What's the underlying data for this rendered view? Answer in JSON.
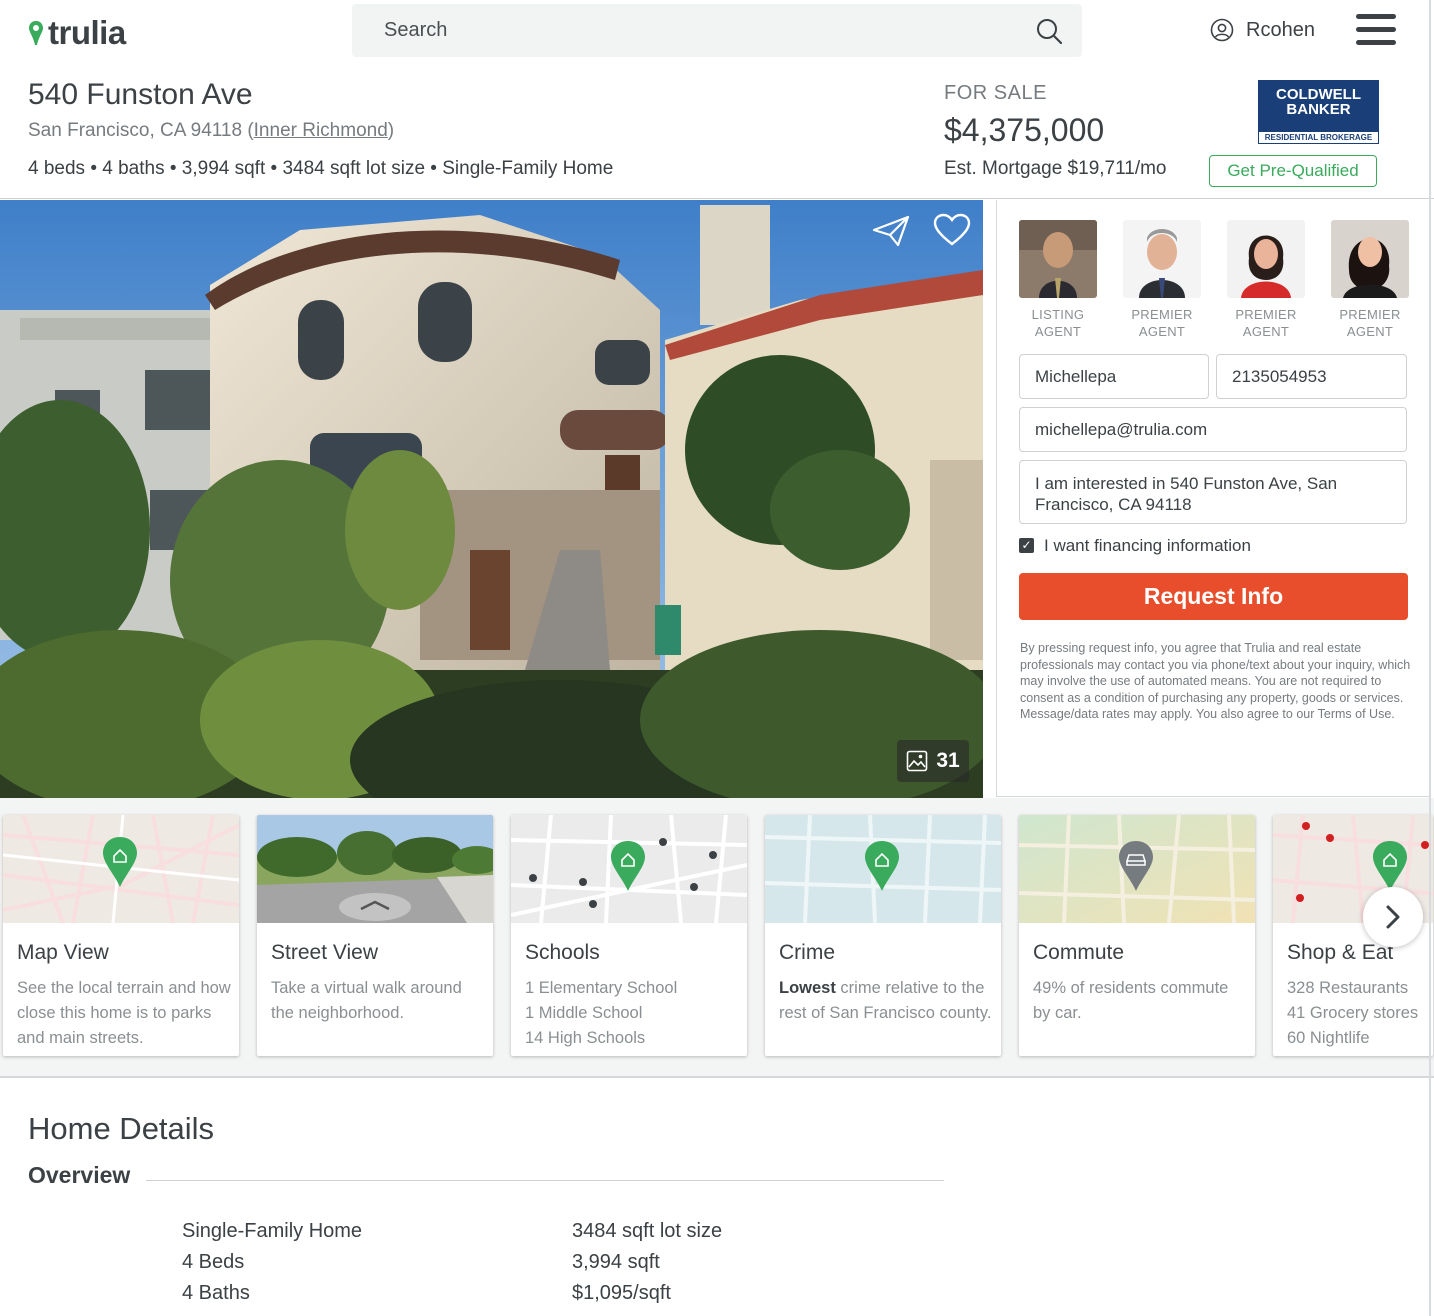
{
  "header": {
    "logo_text": "trulia",
    "search_placeholder": "Search",
    "username": "Rcohen"
  },
  "property": {
    "address": "540 Funston Ave",
    "city_prefix": "San Francisco, CA 94118 (",
    "neighborhood": "Inner Richmond",
    "city_suffix": ")",
    "facts": "4 beds • 4 baths • 3,994 sqft • 3484 sqft lot size • Single-Family Home",
    "status": "FOR SALE",
    "price": "$4,375,000",
    "mortgage": "Est. Mortgage $19,711/mo",
    "prequal_label": "Get Pre-Qualified",
    "brokerage": {
      "line1": "COLDWELL",
      "line2": "BANKER",
      "line3": "RESIDENTIAL BROKERAGE"
    }
  },
  "photo": {
    "count": "31"
  },
  "agents": [
    {
      "role_line1": "LISTING",
      "role_line2": "AGENT"
    },
    {
      "role_line1": "PREMIER",
      "role_line2": "AGENT"
    },
    {
      "role_line1": "PREMIER",
      "role_line2": "AGENT"
    },
    {
      "role_line1": "PREMIER",
      "role_line2": "AGENT"
    }
  ],
  "form": {
    "name": "Michellepa",
    "phone": "2135054953",
    "email": "michellepa@trulia.com",
    "message": "I am interested in 540 Funston Ave, San Francisco, CA 94118",
    "financing_label": "I want financing information",
    "financing_checked": true,
    "submit_label": "Request Info",
    "legal": "By pressing request info, you agree that Trulia and real estate professionals may contact you via phone/text about your inquiry, which may involve the use of automated means. You are not required to consent as a condition of purchasing any property, goods or services. Message/data rates may apply. You also agree to our Terms of Use."
  },
  "cards": [
    {
      "title": "Map View",
      "desc": "See the local terrain and how close this home is to parks and main streets."
    },
    {
      "title": "Street View",
      "desc": "Take a virtual walk around the neighborhood."
    },
    {
      "title": "Schools",
      "desc": "1 Elementary School\n1 Middle School\n14 High Schools"
    },
    {
      "title": "Crime",
      "desc_bold": "Lowest",
      "desc": " crime relative to the rest of San Francisco county."
    },
    {
      "title": "Commute",
      "desc": "49% of residents commute by car."
    },
    {
      "title": "Shop & Eat",
      "desc": "328 Restaurants\n41 Grocery stores\n60 Nightlife"
    }
  ],
  "details": {
    "title": "Home Details",
    "overview_label": "Overview",
    "col1": [
      "Single-Family Home",
      "4 Beds",
      "4 Baths"
    ],
    "col2": [
      "3484 sqft lot size",
      "3,994 sqft",
      "$1,095/sqft"
    ]
  },
  "colors": {
    "brand_green": "#3aaa5c",
    "cta_red": "#e84e2c",
    "text_dark": "#3b4144",
    "text_muted": "#767b7f",
    "brokerage_blue": "#1a3e78"
  }
}
